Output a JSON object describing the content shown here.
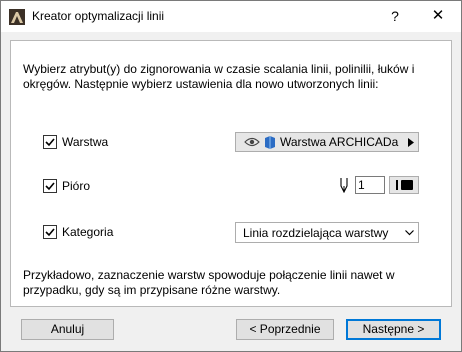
{
  "window": {
    "title": "Kreator optymalizacji linii",
    "help_label": "?",
    "close_label": "✕"
  },
  "description": "Wybierz atrybut(y) do zignorowania w czasie scalania linii, polinilii, łuków i okręgów. Następnie wybierz ustawienia dla nowo utworzonych linii:",
  "options": {
    "layer": {
      "label": "Warstwa",
      "checked": true,
      "value": "Warstwa ARCHICADa"
    },
    "pen": {
      "label": "Pióro",
      "checked": true,
      "value": "1"
    },
    "category": {
      "label": "Kategoria",
      "checked": true,
      "value": "Linia rozdzielająca warstwy"
    }
  },
  "example": "Przykładowo, zaznaczenie warstw spowoduje połączenie linii nawet w przypadku, gdy są im przypisane różne warstwy.",
  "buttons": {
    "cancel": "Anuluj",
    "back": "< Poprzednie",
    "next": "Następne >"
  },
  "colors": {
    "primary_border": "#0078d7"
  },
  "icons": [
    "app-icon",
    "eye-icon",
    "layer-icon",
    "triangle-right-icon",
    "pen-icon",
    "chevron-down-icon",
    "checkbox-check-icon"
  ]
}
